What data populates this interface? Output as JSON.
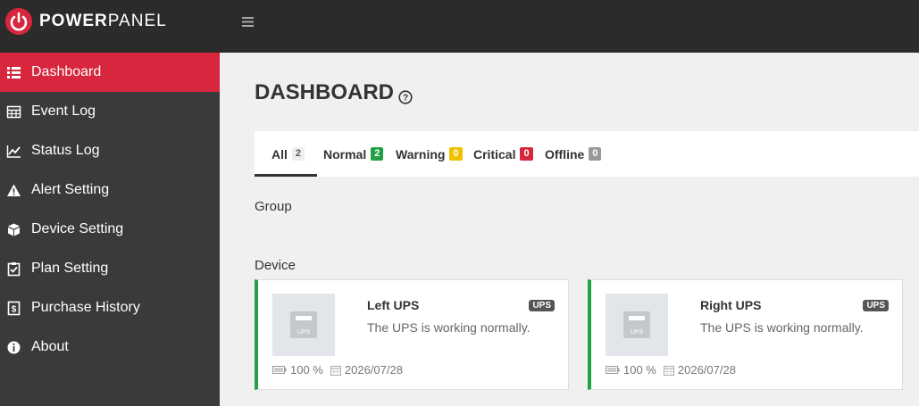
{
  "app": {
    "brand_bold": "POWER",
    "brand_light": "PANEL"
  },
  "sidebar": {
    "items": [
      {
        "label": "Dashboard",
        "icon": "list-icon",
        "active": true
      },
      {
        "label": "Event Log",
        "icon": "table-icon"
      },
      {
        "label": "Status Log",
        "icon": "line-chart-icon"
      },
      {
        "label": "Alert Setting",
        "icon": "warning-icon"
      },
      {
        "label": "Device Setting",
        "icon": "cube-icon"
      },
      {
        "label": "Plan Setting",
        "icon": "clipboard-check-icon"
      },
      {
        "label": "Purchase History",
        "icon": "dollar-document-icon"
      },
      {
        "label": "About",
        "icon": "info-icon"
      }
    ]
  },
  "page": {
    "title": "DASHBOARD"
  },
  "tabs": [
    {
      "label": "All",
      "count": "2",
      "color": "#eeeeee",
      "active": true
    },
    {
      "label": "Normal",
      "count": "2",
      "color": "#22a144"
    },
    {
      "label": "Warning",
      "count": "0",
      "color": "#f0c000"
    },
    {
      "label": "Critical",
      "count": "0",
      "color": "#d7263d"
    },
    {
      "label": "Offline",
      "count": "0",
      "color": "#999999"
    }
  ],
  "sections": {
    "group": "Group",
    "device": "Device"
  },
  "devices": [
    {
      "name": "Left UPS",
      "status": "The UPS is working normally.",
      "tag": "UPS",
      "thumb_label": "UPS",
      "battery": "100 %",
      "date": "2026/07/28"
    },
    {
      "name": "Right UPS",
      "status": "The UPS is working normally.",
      "tag": "UPS",
      "thumb_label": "UPS",
      "battery": "100 %",
      "date": "2026/07/28"
    }
  ],
  "colors": {
    "accent": "#d7263d",
    "normal": "#22a144",
    "sidebar": "#3a3a3a",
    "topbar": "#2b2b2b"
  }
}
